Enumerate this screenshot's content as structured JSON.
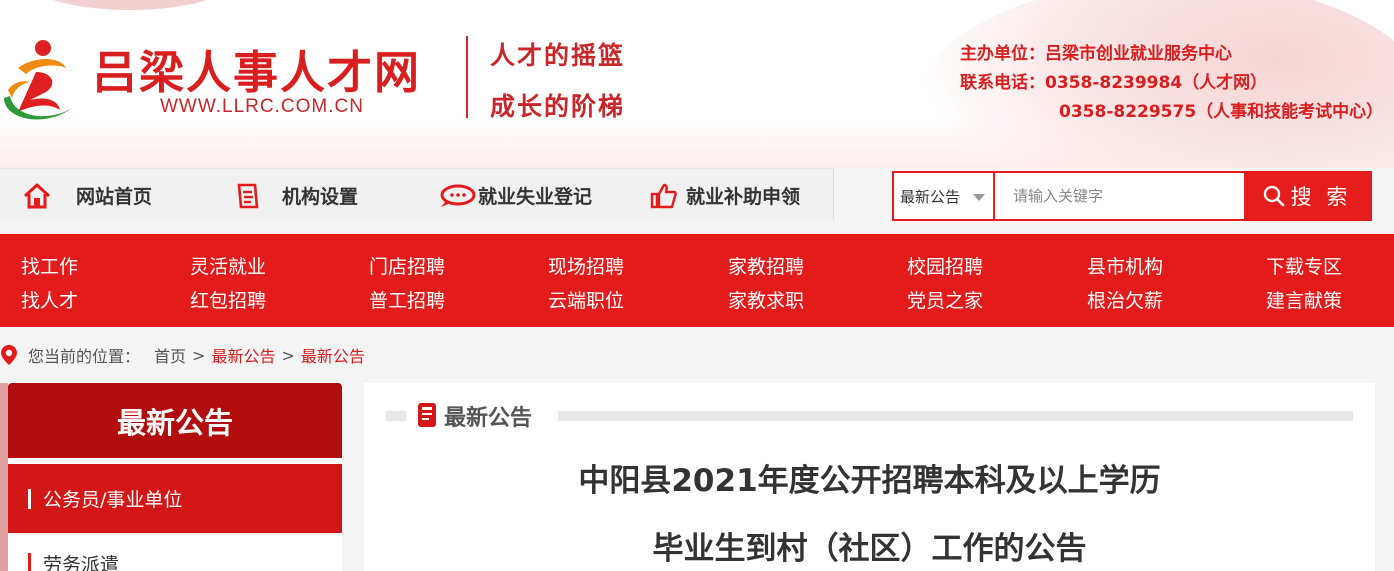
{
  "header": {
    "site_name": "吕梁人事人才网",
    "site_url": "WWW.LLRC.COM.CN",
    "slogan_line1": "人才的摇篮",
    "slogan_line2": "成长的阶梯",
    "organizer": "主办单位：吕梁市创业就业服务中心",
    "phone_line1": "联系电话：0358-8239984（人才网）",
    "phone_line2": "0358-8229575（人事和技能考试中心）"
  },
  "nav": {
    "home": "网站首页",
    "org": "机构设置",
    "register": "就业失业登记",
    "subsidy": "就业补助申领"
  },
  "search": {
    "category": "最新公告",
    "placeholder": "请输入关键字",
    "button": "搜 索"
  },
  "categories": {
    "row1": [
      "找工作",
      "灵活就业",
      "门店招聘",
      "现场招聘",
      "家教招聘",
      "校园招聘",
      "县市机构",
      "下载专区"
    ],
    "row2": [
      "找人才",
      "红包招聘",
      "普工招聘",
      "云端职位",
      "家教求职",
      "党员之家",
      "根治欠薪",
      "建言献策"
    ]
  },
  "breadcrumb": {
    "prefix": "您当前的位置：",
    "home": "首页",
    "sep": ">",
    "level1": "最新公告",
    "level2": "最新公告"
  },
  "sidebar": {
    "title": "最新公告",
    "items": [
      "公务员/事业单位",
      "劳务派遣"
    ]
  },
  "content": {
    "section_title": "最新公告",
    "article_title_line1": "中阳县2021年度公开招聘本科及以上学历",
    "article_title_line2": "毕业生到村（社区）工作的公告"
  },
  "colors": {
    "brand_red": "#e31b1b",
    "dark_red": "#b30e0e",
    "text": "#333333"
  },
  "icons": {
    "home": "home-icon",
    "org": "document-icon",
    "register": "chat-bubble-icon",
    "subsidy": "thumbs-up-icon",
    "search": "search-icon",
    "location": "location-pin-icon",
    "section": "book-icon"
  }
}
